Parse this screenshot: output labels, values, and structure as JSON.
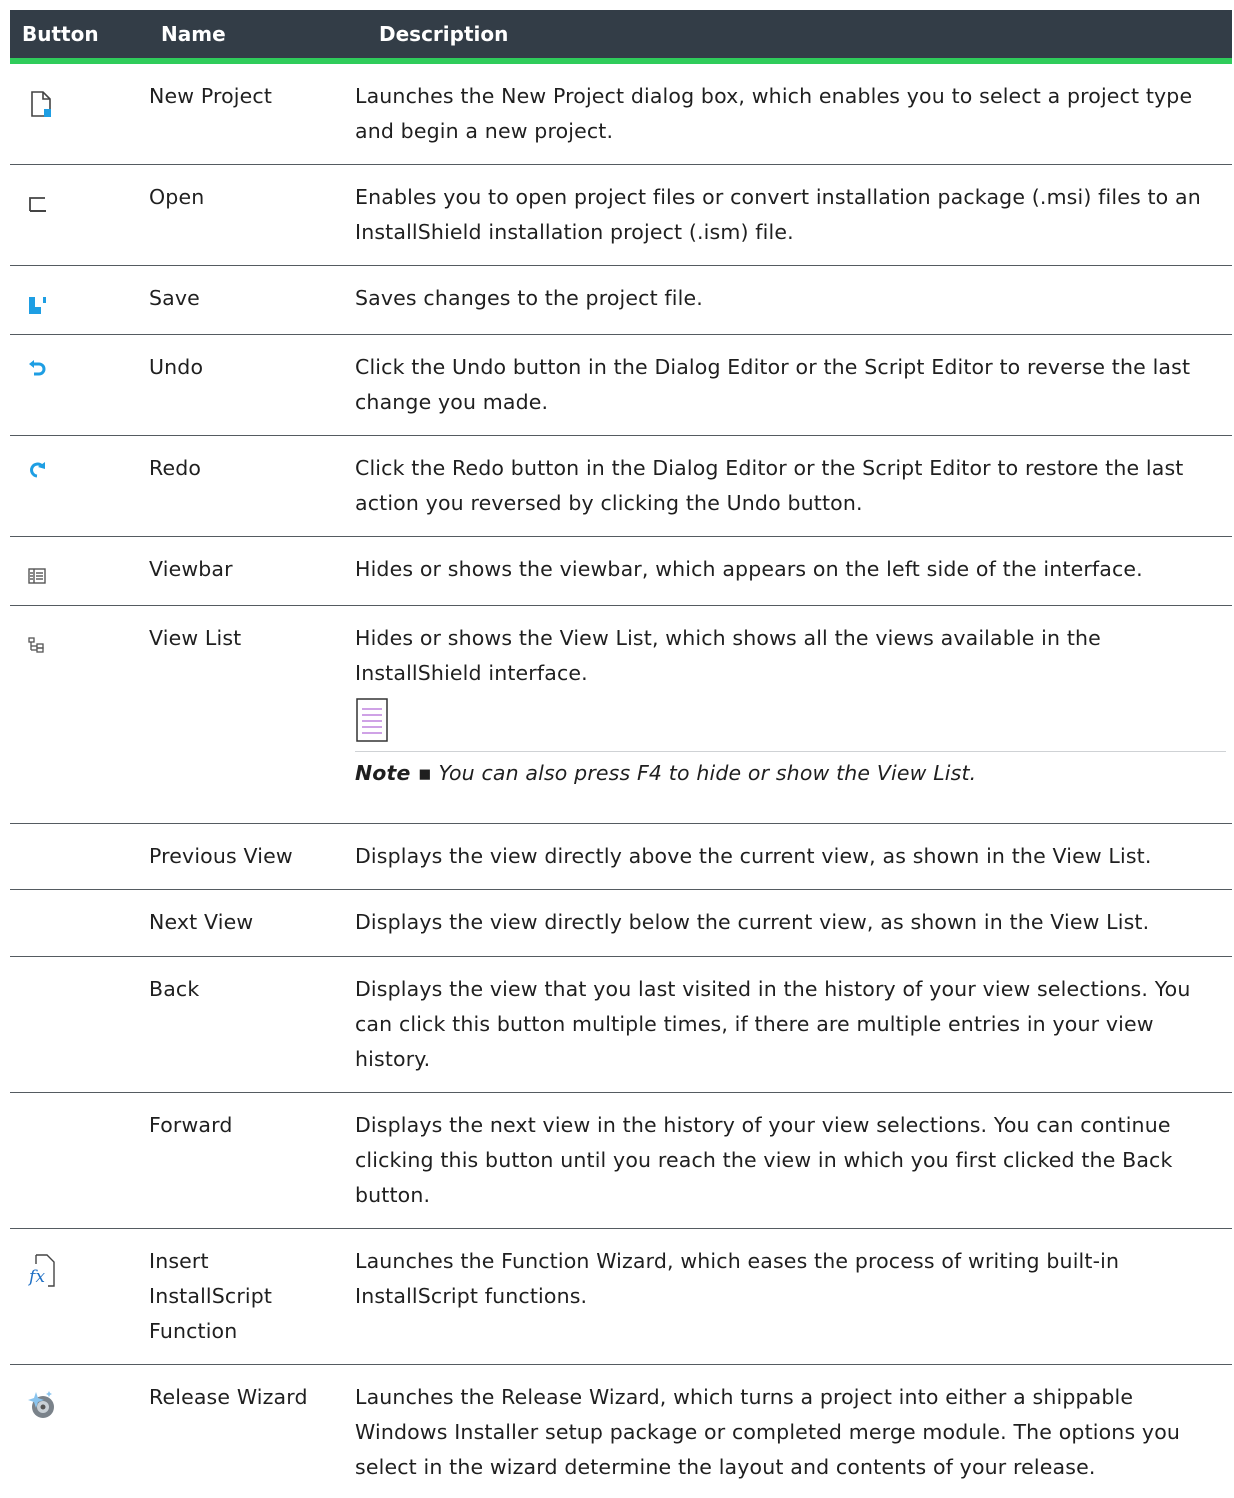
{
  "table": {
    "headers": {
      "button": "Button",
      "name": "Name",
      "description": "Description"
    },
    "rows": [
      {
        "icon": "new-project-icon",
        "name": "New Project",
        "description": "Launches the New Project dialog box, which enables you to select a project type and begin a new project."
      },
      {
        "icon": "open-icon",
        "name": "Open",
        "description": "Enables you to open project files or convert installation package (.msi) files to an InstallShield installation project (.ism) file."
      },
      {
        "icon": "save-icon",
        "name": "Save",
        "description": "Saves changes to the project file."
      },
      {
        "icon": "undo-icon",
        "name": "Undo",
        "description": "Click the Undo button in the Dialog Editor or the Script Editor to reverse the last change you made."
      },
      {
        "icon": "redo-icon",
        "name": "Redo",
        "description": "Click the Redo button in the Dialog Editor or the Script Editor to restore the last action you reversed by clicking the Undo button."
      },
      {
        "icon": "viewbar-icon",
        "name": "Viewbar",
        "description": "Hides or shows the viewbar, which appears on the left side of the interface."
      },
      {
        "icon": "view-list-icon",
        "name": "View List",
        "description": "Hides or shows the View List, which shows all the views available in the InstallShield interface.",
        "note_label": "Note ▪",
        "note_text": "You can also press F4 to hide or show the View List."
      },
      {
        "icon": "",
        "name": "Previous View",
        "description": "Displays the view directly above the current view, as shown in the View List."
      },
      {
        "icon": "",
        "name": "Next View",
        "description": "Displays the view directly below the current view, as shown in the View List."
      },
      {
        "icon": "",
        "name": "Back",
        "description": "Displays the view that you last visited in the history of your view selections. You can click this button multiple times, if there are multiple entries in your view history."
      },
      {
        "icon": "",
        "name": "Forward",
        "description": "Displays the next view in the history of your view selections. You can continue clicking this button until you reach the view in which you first clicked the Back button."
      },
      {
        "icon": "function-fx-icon",
        "name": "Insert InstallScript Function",
        "description": "Launches the Function Wizard, which eases the process of writing built-in InstallScript functions."
      },
      {
        "icon": "release-wizard-icon",
        "name": "Release Wizard",
        "description": "Launches the Release Wizard, which turns a project into either a shippable Windows Installer setup package or completed merge module. The options you select in the wizard determine the layout and contents of your release."
      }
    ]
  },
  "colors": {
    "header_bg": "#333d47",
    "header_rule": "#2fcc5b",
    "icon_blue": "#1e9ee3"
  }
}
